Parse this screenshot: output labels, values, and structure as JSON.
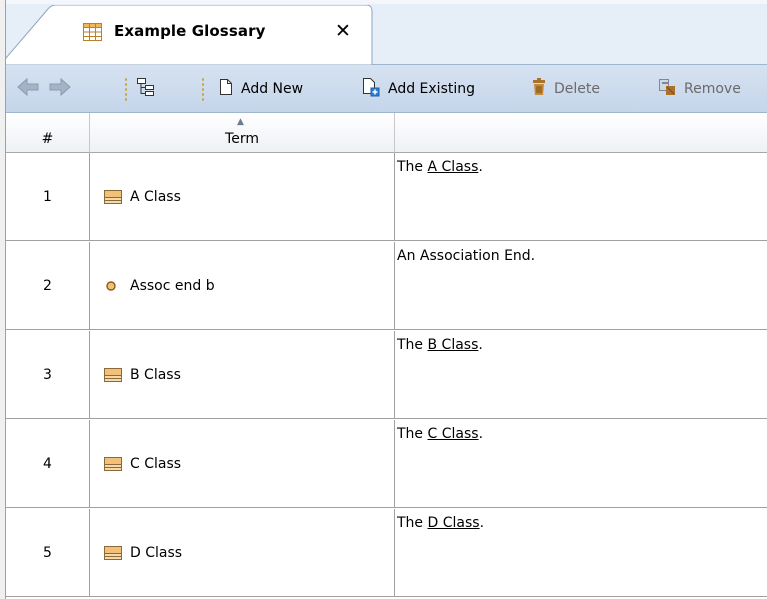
{
  "tab": {
    "title": "Example Glossary",
    "close_glyph": "✕",
    "icon": "table-icon"
  },
  "toolbar": {
    "back_icon": "back-arrow-icon",
    "forward_icon": "forward-arrow-icon",
    "tree_icon": "hierarchy-icon",
    "add_new": "Add New",
    "add_existing": "Add Existing",
    "delete": "Delete",
    "remove": "Remove"
  },
  "columns": [
    {
      "label": "#"
    },
    {
      "label": "Term",
      "sorted": "ascending"
    },
    {
      "label": ""
    }
  ],
  "rows": [
    {
      "num": "1",
      "term": "A Class",
      "icon": "class-icon",
      "desc_pre": "The ",
      "desc_link": "A Class",
      "desc_post": "."
    },
    {
      "num": "2",
      "term": "Assoc end b",
      "icon": "association-end-icon",
      "desc_pre": "An Association End.",
      "desc_link": "",
      "desc_post": ""
    },
    {
      "num": "3",
      "term": "B Class",
      "icon": "class-icon",
      "desc_pre": "The ",
      "desc_link": "B Class",
      "desc_post": "."
    },
    {
      "num": "4",
      "term": "C Class",
      "icon": "class-icon",
      "desc_pre": "The ",
      "desc_link": "C Class",
      "desc_post": "."
    },
    {
      "num": "5",
      "term": "D Class",
      "icon": "class-icon",
      "desc_pre": "The ",
      "desc_link": "D Class",
      "desc_post": "."
    }
  ]
}
